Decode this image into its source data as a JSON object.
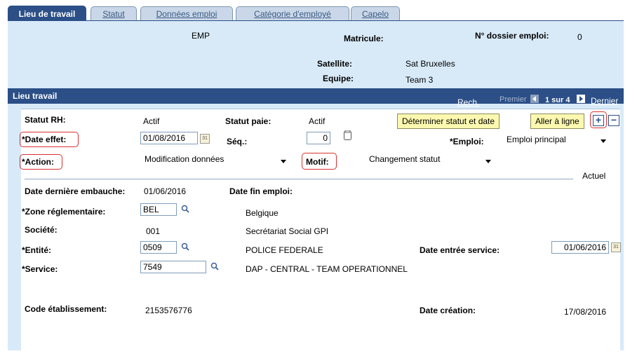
{
  "tabs": [
    {
      "label": "Lieu de travail"
    },
    {
      "label": "Statut"
    },
    {
      "label": "Données emploi"
    },
    {
      "label": "Catégorie d'employé"
    },
    {
      "label": "Capelo"
    }
  ],
  "header": {
    "employee": "EMP",
    "matricule_label": "Matricule:",
    "dossier_label": "N° dossier emploi:",
    "dossier_value": "0",
    "satellite_label": "Satellite:",
    "satellite_value": "Sat Bruxelles",
    "equipe_label": "Equipe:",
    "equipe_value": "Team 3"
  },
  "section": {
    "title": "Lieu travail",
    "search_link": "Rech.",
    "first_label": "Premier",
    "page_info": "1 sur 4",
    "last_label": "Dernier"
  },
  "form": {
    "statut_rh_label": "Statut RH:",
    "statut_rh_value": "Actif",
    "statut_paie_label": "Statut paie:",
    "statut_paie_value": "Actif",
    "determine_button": "Déterminer statut et date",
    "goto_line_button": "Aller à ligne",
    "add_symbol": "+",
    "remove_symbol": "−",
    "date_effet_label": "*Date effet:",
    "date_effet_value": "01/08/2016",
    "seq_label": "Séq.:",
    "seq_value": "0",
    "emploi_label": "*Emploi:",
    "emploi_value": "Emploi principal",
    "action_label": "*Action:",
    "action_value": "Modification données",
    "motif_label": "Motif:",
    "motif_value": "Changement statut",
    "actuel_label": "Actuel",
    "derniere_embauche_label": "Date dernière embauche:",
    "derniere_embauche_value": "01/06/2016",
    "fin_emploi_label": "Date fin emploi:",
    "zone_label": "*Zone réglementaire:",
    "zone_value": "BEL",
    "zone_desc": "Belgique",
    "societe_label": "Société:",
    "societe_value": "001",
    "societe_desc": "Secrétariat Social GPI",
    "entite_label": "*Entité:",
    "entite_value": "0509",
    "entite_desc": "POLICE FEDERALE",
    "entree_service_label": "Date entrée service:",
    "entree_service_value": "01/06/2016",
    "service_label": "*Service:",
    "service_value": "7549",
    "service_desc": "DAP - CENTRAL - TEAM OPERATIONNEL",
    "code_etab_label": "Code établissement:",
    "code_etab_value": "2153576776",
    "date_creation_label": "Date création:",
    "date_creation_value": "17/08/2016",
    "calendar_glyph": "31"
  },
  "colors": {
    "tab_active": "#2b4f86",
    "tab_inactive": "#c9d7e8",
    "panel_bg": "#d8eaf8",
    "button_bg": "#fdf8b0",
    "highlight_red": "#d93030"
  }
}
